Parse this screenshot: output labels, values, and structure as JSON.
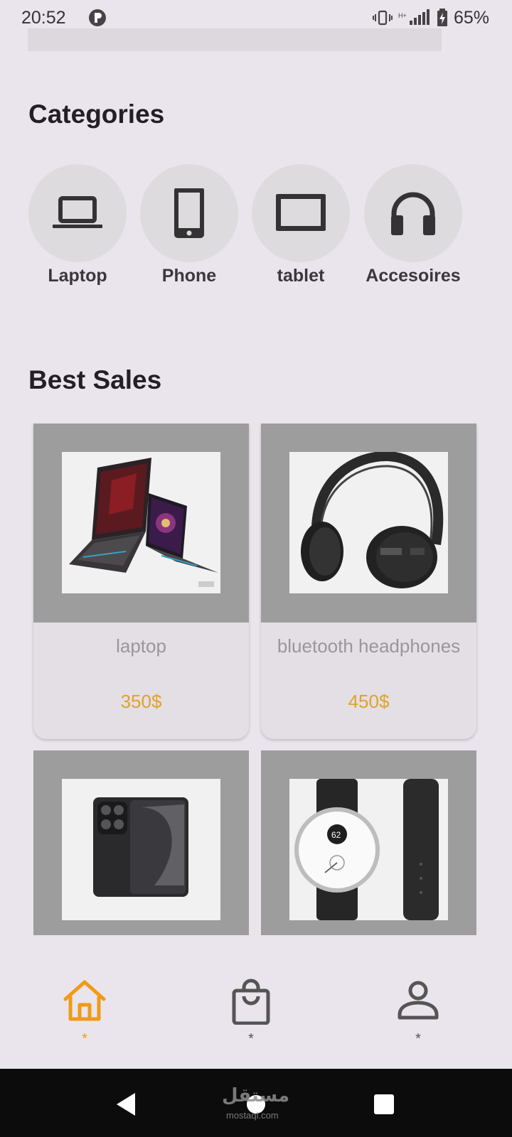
{
  "status_bar": {
    "time": "20:52",
    "battery": "65%",
    "app_icon": "p-circle-icon",
    "icons": [
      "vibrate-icon",
      "signal-icon",
      "battery-charging-icon"
    ]
  },
  "categories": {
    "title": "Categories",
    "items": [
      {
        "label": "Laptop",
        "icon": "laptop-icon"
      },
      {
        "label": "Phone",
        "icon": "phone-icon"
      },
      {
        "label": "tablet",
        "icon": "tablet-icon"
      },
      {
        "label": "Accesoires",
        "icon": "headphones-icon"
      }
    ]
  },
  "best_sales": {
    "title": "Best Sales",
    "products": [
      {
        "name": "laptop",
        "price": "350$",
        "image": "laptop-image"
      },
      {
        "name": "bluetooth headphones",
        "price": "450$",
        "image": "headphones-image"
      },
      {
        "name": "",
        "price": "",
        "image": "phone-image"
      },
      {
        "name": "",
        "price": "",
        "image": "watch-image"
      }
    ]
  },
  "bottom_nav": {
    "items": [
      {
        "icon": "home-icon",
        "label": "*",
        "active": true
      },
      {
        "icon": "shopping-bag-icon",
        "label": "*",
        "active": false
      },
      {
        "icon": "user-icon",
        "label": "*",
        "active": false
      }
    ]
  },
  "system_nav": {
    "buttons": [
      "back-icon",
      "home-circle-icon",
      "recents-icon"
    ],
    "watermark": "مستقل",
    "watermark_sub": "mostaql.com"
  },
  "colors": {
    "accent": "#F09A16",
    "price": "#E0A32A",
    "background": "#EAE5EC",
    "image_frame": "#9D9D9D"
  }
}
